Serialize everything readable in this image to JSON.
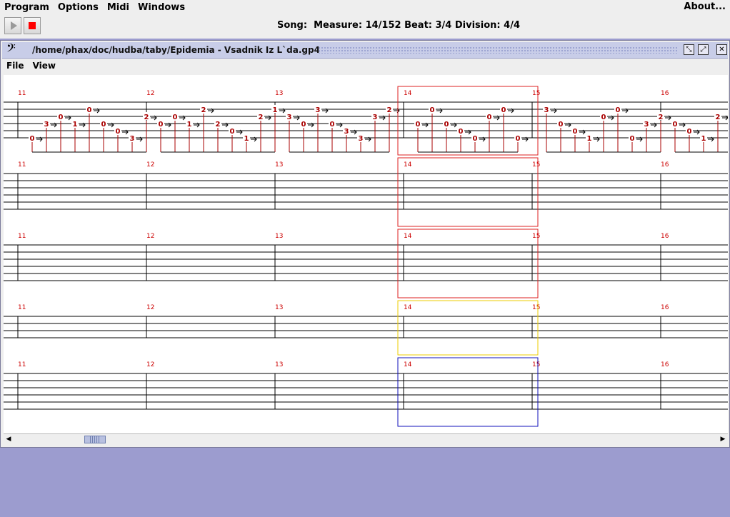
{
  "menubar": {
    "items": [
      "Program",
      "Options",
      "Midi",
      "Windows"
    ],
    "about": "About..."
  },
  "toolbar": {
    "play_icon": "play-icon",
    "stop_icon": "stop-icon",
    "status": "Song:  Measure: 14/152 Beat: 3/4 Division: 4/4"
  },
  "frame": {
    "title": "/home/phax/doc/hudba/taby/Epidemia - Vsadnik Iz L`da.gp4",
    "clef_icon": "bass-clef-icon",
    "menu": [
      "File",
      "View"
    ]
  },
  "score": {
    "measure_numbers": [
      "11",
      "12",
      "13",
      "14",
      "15",
      "16"
    ],
    "current_measure": "14",
    "colors": {
      "measure_number": "#cc0000",
      "note": "#aa0000",
      "track_highlights": [
        "#dd2222",
        "#dd2222",
        "#dd2222",
        "#eecc00",
        "#1111bb"
      ],
      "staff": "#000000"
    },
    "tracks": [
      {
        "strings": 6,
        "measures": [
          [
            "0",
            "3",
            "0",
            "1",
            "0",
            "0",
            "0",
            "3",
            "2"
          ],
          [
            "0",
            "0",
            "1",
            "2",
            "2",
            "0",
            "1",
            "2",
            "1"
          ],
          [
            "3",
            "0",
            "3",
            "0",
            "3",
            "3",
            "3",
            "2"
          ],
          [
            "0",
            "0",
            "0",
            "0",
            "0",
            "0",
            "0",
            "0"
          ],
          [
            "3",
            "0",
            "0",
            "1",
            "0",
            "0",
            "0",
            "3",
            "2"
          ],
          [
            "0",
            "0",
            "1",
            "2",
            "2"
          ]
        ]
      },
      {
        "strings": 6,
        "measures": []
      },
      {
        "strings": 6,
        "measures": []
      },
      {
        "strings": 4,
        "measures": []
      },
      {
        "strings": 6,
        "measures": []
      }
    ]
  },
  "scrollbar": {
    "position": 0.06
  }
}
